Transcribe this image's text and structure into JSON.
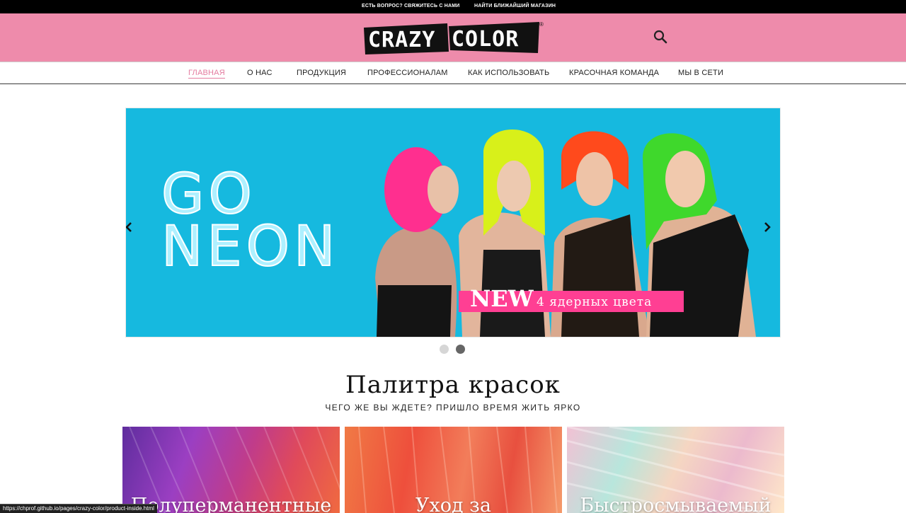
{
  "topbar": {
    "contact": "ЕСТЬ ВОПРОС? СВЯЖИТЕСЬ С НАМИ",
    "store": "НАЙТИ БЛИЖАЙШИЙ МАГАЗИН"
  },
  "header": {
    "logo_text_1": "CRAZY",
    "logo_text_2": "COLOR",
    "logo_mark": "®",
    "search_icon": "search-icon"
  },
  "nav": {
    "items": [
      {
        "label": "ГЛАВНАЯ",
        "active": true
      },
      {
        "label": "О НАС",
        "active": false
      },
      {
        "label": "ПРОДУКЦИЯ",
        "active": false
      },
      {
        "label": "ПРОФЕССИОНАЛАМ",
        "active": false
      },
      {
        "label": "КАК ИСПОЛЬЗОВАТЬ",
        "active": false
      },
      {
        "label": "КРАСОЧНАЯ КОМАНДА",
        "active": false
      },
      {
        "label": "МЫ В СЕТИ",
        "active": false
      }
    ],
    "active_color": "#e47ca0"
  },
  "slider": {
    "headline_1": "GO",
    "headline_2": "NEON",
    "badge_new": "NEW",
    "badge_text": "4 ядерных цвета",
    "background": "#16b9df",
    "hair_colors": [
      "#ff2f8f",
      "#d8f01a",
      "#ff4a1c",
      "#3fd82c"
    ],
    "active_slide": 2,
    "slide_count": 2
  },
  "palette": {
    "title": "Палитра красок",
    "subtitle": "ЧЕГО ЖЕ ВЫ ЖДЕТЕ? ПРИШЛО ВРЕМЯ ЖИТЬ ЯРКО",
    "cards": [
      {
        "label": "Полуперманентные"
      },
      {
        "label": "Уход за"
      },
      {
        "label": "Быстросмываемый"
      }
    ]
  },
  "status": {
    "url": "https://chprof.github.io/pages/crazy-color/product-inside.html"
  },
  "colors": {
    "header_pink": "#ee8bab",
    "topbar_black": "#000000"
  }
}
